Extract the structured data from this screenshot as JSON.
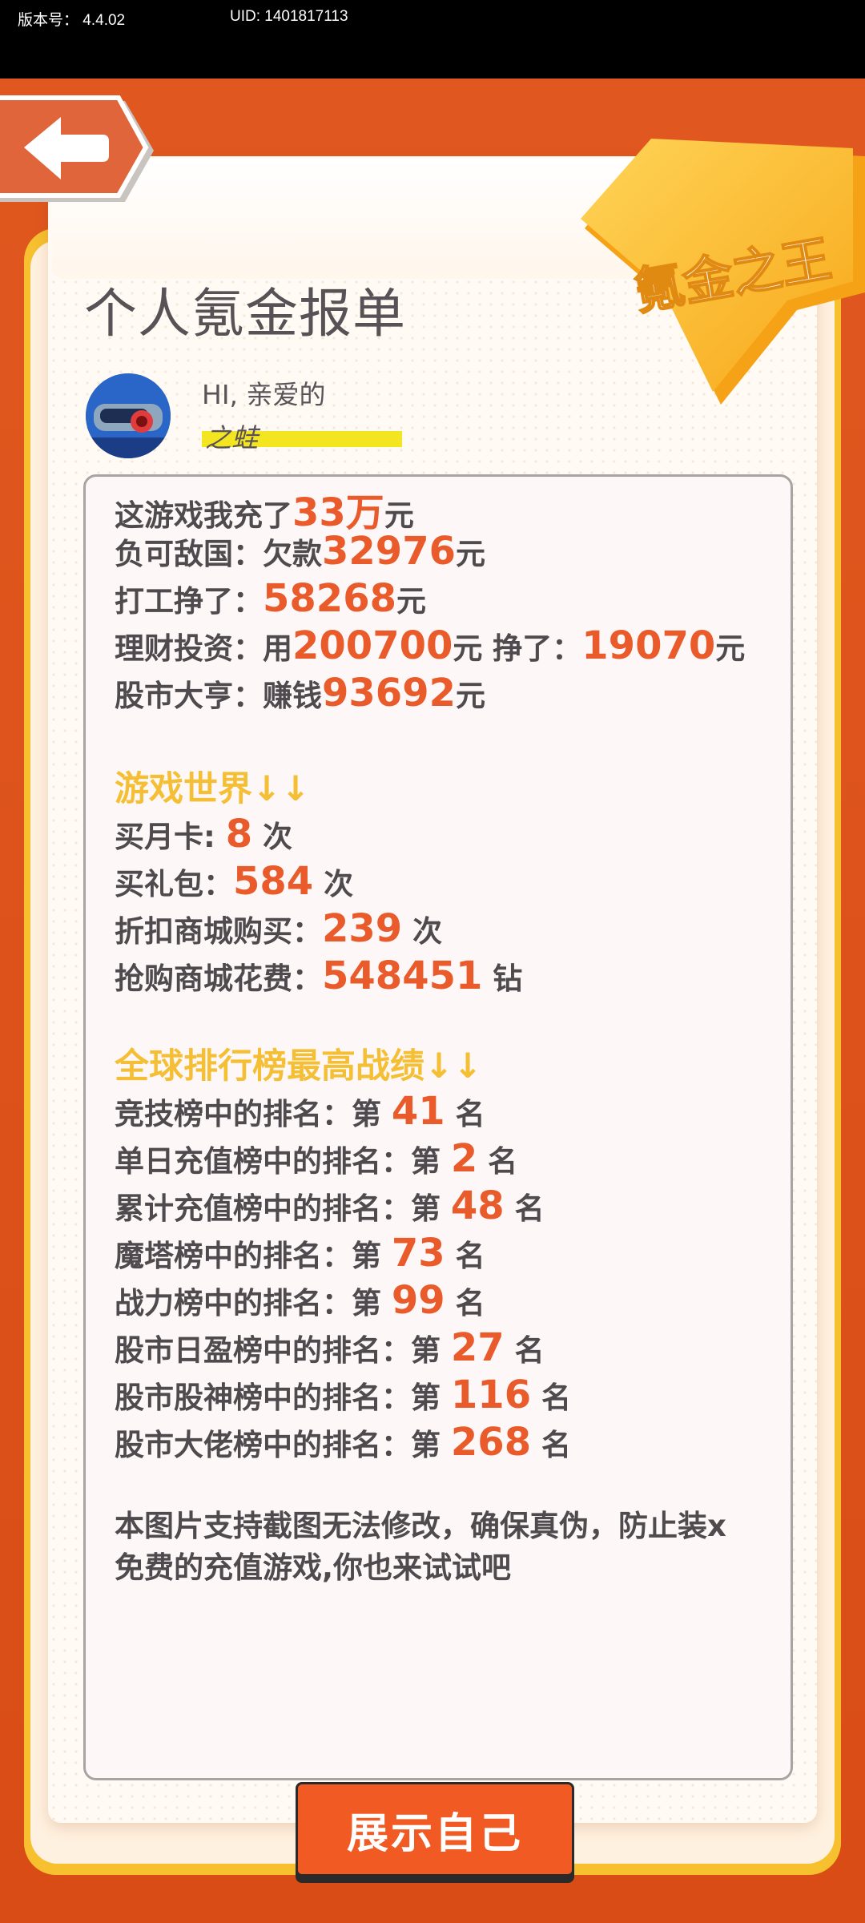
{
  "status": {
    "version_label": "版本号：  4.4.02",
    "uid_label": "UID: 1401817113"
  },
  "header": {
    "title": "个人氪金报单",
    "badge_text": "氪金之王"
  },
  "user": {
    "greeting": "HI, 亲爱的",
    "name": "之蛙"
  },
  "stats": [
    {
      "prefix": "这游戏我充了",
      "value": "33万",
      "suffix": "元"
    },
    {
      "prefix": "负可敌国：欠款",
      "value": "32976",
      "suffix": "元"
    },
    {
      "prefix": "打工挣了：",
      "value": "58268",
      "suffix": "元"
    }
  ],
  "invest": {
    "prefix": "理财投资：用",
    "value1": "200700",
    "mid": "元  挣了：",
    "value2": "19070",
    "suffix": "元"
  },
  "stock": {
    "prefix": "股市大亨：赚钱",
    "value": "93692",
    "suffix": "元"
  },
  "game_section_title": "游戏世界↓↓",
  "game_stats": [
    {
      "prefix": "买月卡: ",
      "value": "8",
      "suffix": " 次"
    },
    {
      "prefix": "买礼包：",
      "value": "584",
      "suffix": " 次"
    },
    {
      "prefix": "折扣商城购买：",
      "value": "239",
      "suffix": " 次"
    },
    {
      "prefix": "抢购商城花费：",
      "value": "548451",
      "suffix": " 钻"
    }
  ],
  "rank_section_title": "全球排行榜最高战绩↓↓",
  "ranks": [
    {
      "prefix": "竞技榜中的排名：第 ",
      "value": "41",
      "suffix": " 名"
    },
    {
      "prefix": "单日充值榜中的排名：第 ",
      "value": "2",
      "suffix": " 名"
    },
    {
      "prefix": "累计充值榜中的排名：第 ",
      "value": "48",
      "suffix": " 名"
    },
    {
      "prefix": "魔塔榜中的排名：第 ",
      "value": "73",
      "suffix": " 名"
    },
    {
      "prefix": "战力榜中的排名：第 ",
      "value": "99",
      "suffix": " 名"
    },
    {
      "prefix": "股市日盈榜中的排名：第 ",
      "value": "27",
      "suffix": " 名"
    },
    {
      "prefix": "股市股神榜中的排名：第 ",
      "value": "116",
      "suffix": " 名"
    },
    {
      "prefix": "股市大佬榜中的排名：第 ",
      "value": "268",
      "suffix": " 名"
    }
  ],
  "footer": {
    "line1": "本图片支持截图无法修改，确保真伪，防止装x",
    "line2": "免费的充值游戏,你也来试试吧"
  },
  "show_button_label": "展示自己",
  "colors": {
    "accent_orange": "#e95b2b",
    "section_yellow": "#f5bf35",
    "button_orange": "#f15a22",
    "background_orange": "#d9511c"
  }
}
